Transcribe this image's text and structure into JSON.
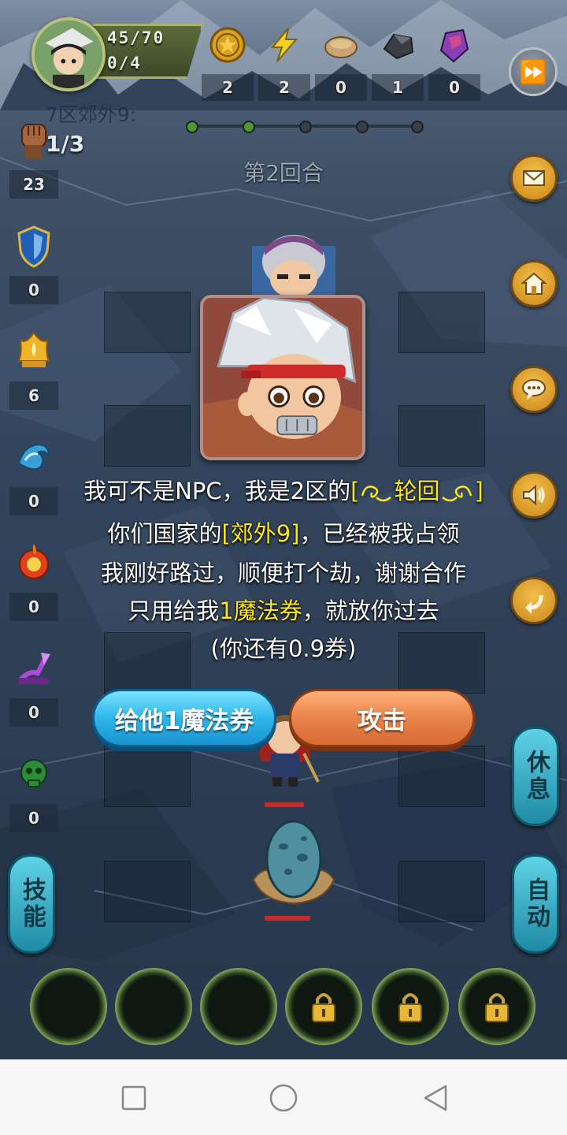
{
  "hud": {
    "hp": "45/70",
    "energy": "0/4",
    "resources": [
      {
        "icon": "gold-coin-icon",
        "count": "2"
      },
      {
        "icon": "lightning-icon",
        "count": "2"
      },
      {
        "icon": "bread-icon",
        "count": "0"
      },
      {
        "icon": "iron-ore-icon",
        "count": "1"
      },
      {
        "icon": "crystal-icon",
        "count": "0"
      }
    ]
  },
  "stage": {
    "name": "7区郊外9:",
    "progress": "1/3",
    "round": "第2回合",
    "progress_dots": [
      "#4a9a2e",
      "#4a9a2e",
      "#3a3f47",
      "#3a3f47",
      "#3a3f47"
    ]
  },
  "statuses": [
    {
      "icon": "fist-icon",
      "count": "23"
    },
    {
      "icon": "shield-icon",
      "count": "0"
    },
    {
      "icon": "flame-crown-icon",
      "count": "6"
    },
    {
      "icon": "water-wave-icon",
      "count": "0"
    },
    {
      "icon": "fire-ring-icon",
      "count": "0"
    },
    {
      "icon": "lightning-mark-icon",
      "count": "0"
    },
    {
      "icon": "poison-skull-icon",
      "count": "0"
    }
  ],
  "buttons": {
    "rest": "休息",
    "auto": "自动",
    "skill": "技能"
  },
  "dialog": {
    "line1_a": "我可不是NPC，我是2区的",
    "line1_b": "[",
    "line1_name": "轮回",
    "line1_c": "]",
    "line2_a": "你们国家的",
    "line2_place": "[郊外9]",
    "line2_b": "，已经被我占领",
    "line3": "我刚好路过，顺便打个劫，谢谢合作",
    "line4_a": "只用给我",
    "line4_amount": "1魔法券",
    "line4_b": "，就放你过去",
    "line5": "(你还有0.9券)",
    "give_button": "给他1魔法券",
    "attack_button": "攻击"
  },
  "colors": {
    "highlight": "#ffe81a",
    "give_button": "#2fb6ea",
    "attack_button": "#e8844a"
  }
}
